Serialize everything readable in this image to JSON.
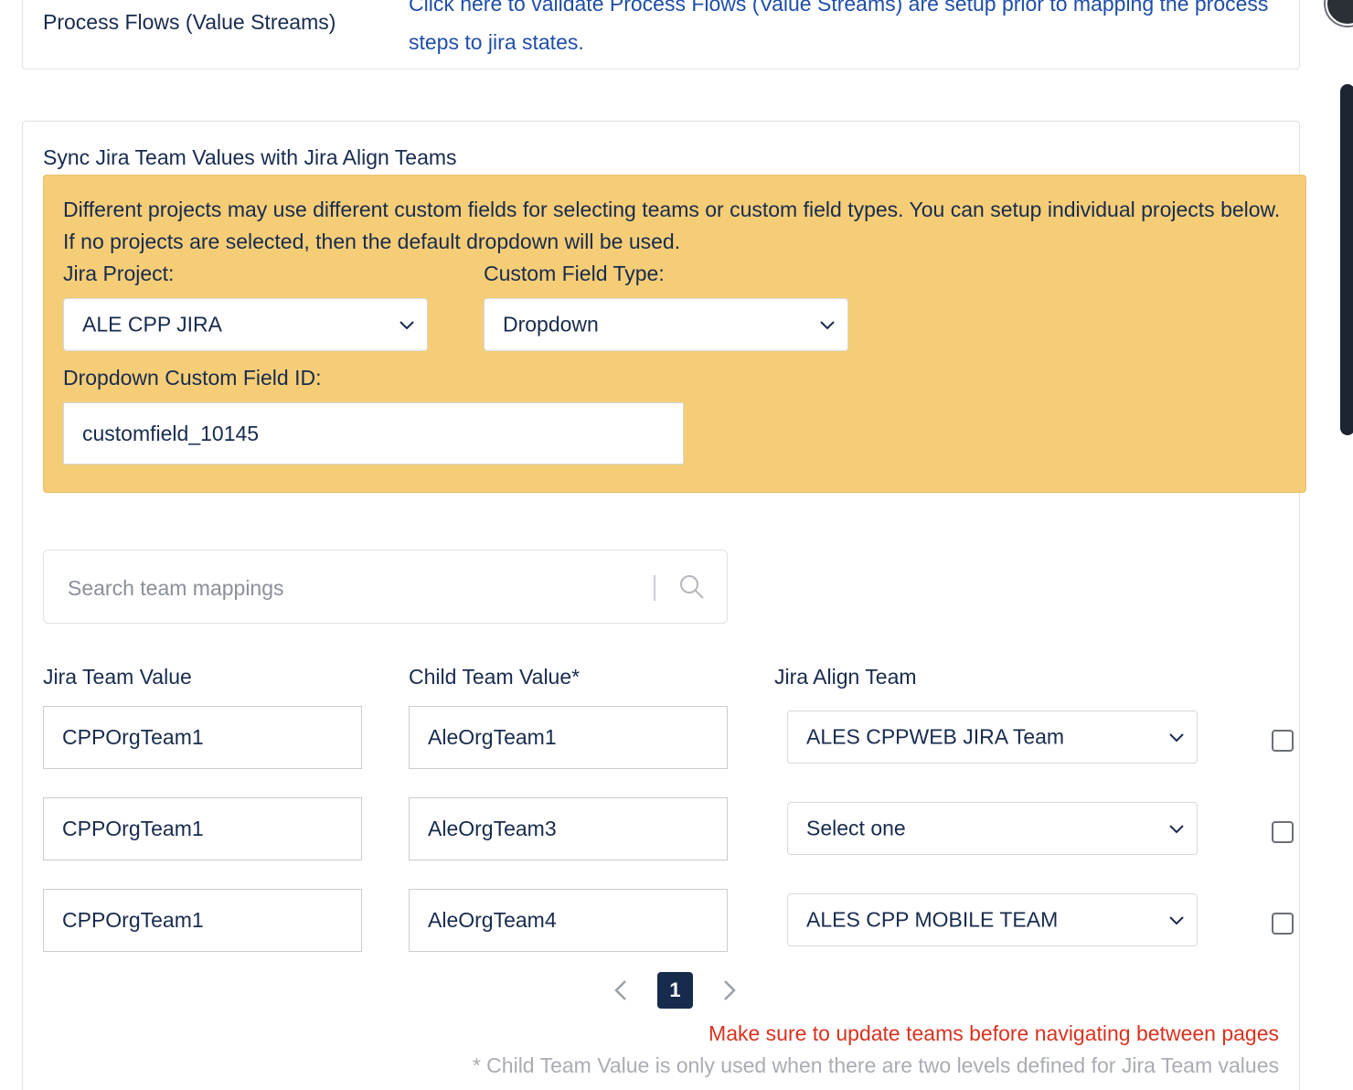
{
  "process_flows": {
    "label": "Process Flows (Value Streams)",
    "link_text": "Click here to validate Process Flows (Value Streams) are setup prior to mapping the process steps to jira states."
  },
  "sync_section": {
    "title": "Sync Jira Team Values with Jira Align Teams",
    "warning_text": "Different projects may use different custom fields for selecting teams or custom field types. You can setup individual projects below. If no projects are selected, then the default dropdown will be used.",
    "jira_project_label": "Jira Project:",
    "jira_project_value": "ALE CPP JIRA",
    "custom_field_type_label": "Custom Field Type:",
    "custom_field_type_value": "Dropdown",
    "dropdown_field_id_label": "Dropdown Custom Field ID:",
    "dropdown_field_id_value": "customfield_10145"
  },
  "search": {
    "placeholder": "Search team mappings",
    "icon": "search-icon"
  },
  "table": {
    "headers": {
      "jira_team_value": "Jira Team Value",
      "child_team_value": "Child Team Value*",
      "jira_align_team": "Jira Align Team"
    },
    "rows": [
      {
        "jira_team": "CPPOrgTeam1",
        "child_team": "AleOrgTeam1",
        "align_team": "ALES CPPWEB JIRA Team",
        "checked": false
      },
      {
        "jira_team": "CPPOrgTeam1",
        "child_team": "AleOrgTeam3",
        "align_team": "Select one",
        "checked": false
      },
      {
        "jira_team": "CPPOrgTeam1",
        "child_team": "AleOrgTeam4",
        "align_team": "ALES CPP MOBILE TEAM",
        "checked": false
      }
    ]
  },
  "pagination": {
    "current_page": "1",
    "warning": "Make sure to update teams before navigating between pages",
    "note": "* Child Team Value is only used when there are two levels defined for Jira Team values"
  },
  "colors": {
    "warning_bg": "#f6cd77",
    "link": "#1f4ea8",
    "error_text": "#d8321f",
    "page_active": "#172b4d"
  }
}
